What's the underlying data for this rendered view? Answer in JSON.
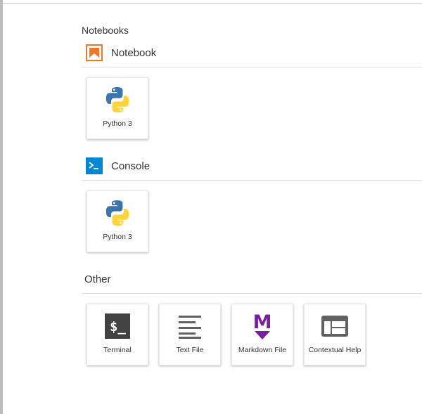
{
  "launcher": {
    "title": "Notebooks",
    "sections": {
      "notebook": {
        "title": "Notebook",
        "icon": "notebook-bookmark-icon",
        "icon_color": "#F37726",
        "cards": [
          {
            "label": "Python 3",
            "icon": "python-logo-icon"
          }
        ]
      },
      "console": {
        "title": "Console",
        "icon": "console-prompt-icon",
        "icon_color": "#0288D1",
        "cards": [
          {
            "label": "Python 3",
            "icon": "python-logo-icon"
          }
        ]
      },
      "other": {
        "title": "Other",
        "cards": [
          {
            "label": "Terminal",
            "icon": "terminal-icon"
          },
          {
            "label": "Text File",
            "icon": "text-file-icon"
          },
          {
            "label": "Markdown File",
            "icon": "markdown-icon",
            "icon_color": "#7B1FA2"
          },
          {
            "label": "Contextual Help",
            "icon": "contextual-help-icon"
          }
        ]
      }
    }
  },
  "colors": {
    "python_blue": "#3A75B0",
    "python_yellow": "#FFD43B",
    "dark_icon": "#424242"
  }
}
